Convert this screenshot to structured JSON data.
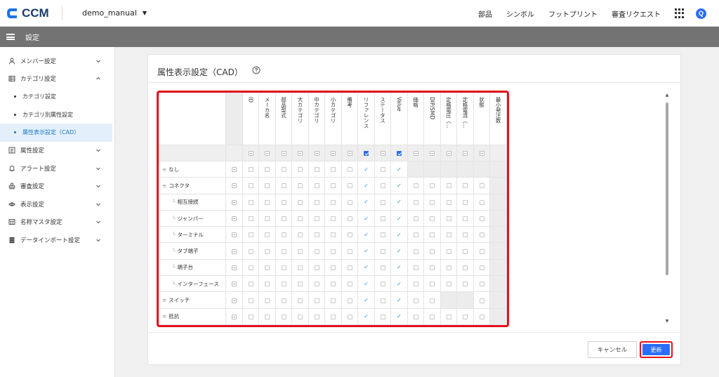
{
  "app": {
    "name": "CCM",
    "project": "demo_manual",
    "accent": "#2a6ef5",
    "highlight": "#e6101c"
  },
  "topnav": [
    {
      "label": "部品"
    },
    {
      "label": "シンボル"
    },
    {
      "label": "フットプリント"
    },
    {
      "label": "審査リクエスト"
    }
  ],
  "user_initial": "Q",
  "subbar": {
    "title": "設定"
  },
  "sidebar": {
    "items": [
      {
        "label": "メンバー設定",
        "icon": "person-icon",
        "chevron": "down"
      },
      {
        "label": "カテゴリ設定",
        "icon": "grid-icon",
        "chevron": "up"
      },
      {
        "label": "属性設定",
        "icon": "list-icon",
        "chevron": "down"
      },
      {
        "label": "アラート設定",
        "icon": "bell-icon",
        "chevron": "down"
      },
      {
        "label": "審査設定",
        "icon": "stamp-icon",
        "chevron": "down"
      },
      {
        "label": "表示設定",
        "icon": "eye-icon",
        "chevron": "down"
      },
      {
        "label": "名称マスタ設定",
        "icon": "table-icon",
        "chevron": "down"
      },
      {
        "label": "データインポート設定",
        "icon": "database-icon",
        "chevron": "down"
      }
    ],
    "subitems": [
      {
        "label": "カテゴリ設定"
      },
      {
        "label": "カテゴリ別属性設定"
      },
      {
        "label": "属性表示設定（CAD）",
        "active": true
      }
    ]
  },
  "page": {
    "title": "属性表示設定（CAD）"
  },
  "table": {
    "columns": [
      "ID",
      "メーカ名",
      "部品型式",
      "大カテゴリ",
      "中カテゴリ",
      "小カテゴリ",
      "備考",
      "リファレンス",
      "ステータス",
      "Value",
      "価格",
      "DIP/SMD",
      "定格電圧（…",
      "定格電流（…",
      "状態",
      "最小発注数"
    ],
    "header_checked": [
      false,
      false,
      false,
      false,
      false,
      false,
      false,
      true,
      false,
      true,
      false,
      false,
      false,
      false,
      false
    ],
    "rows": [
      {
        "label": "なし",
        "level": 0,
        "cells": [
          "o",
          "o",
          "o",
          "o",
          "o",
          "o",
          "o",
          "t",
          "o",
          "t",
          "g",
          "g",
          "g",
          "g",
          "g"
        ]
      },
      {
        "label": "コネクタ",
        "level": 0,
        "cells": [
          "o",
          "o",
          "o",
          "o",
          "o",
          "o",
          "o",
          "t",
          "o",
          "t",
          "o",
          "o",
          "o",
          "o",
          "o"
        ]
      },
      {
        "label": "相互接続",
        "level": 1,
        "cells": [
          "o",
          "o",
          "o",
          "o",
          "o",
          "o",
          "o",
          "t",
          "o",
          "t",
          "o",
          "o",
          "o",
          "o",
          "o"
        ]
      },
      {
        "label": "ジャンパー",
        "level": 1,
        "cells": [
          "o",
          "o",
          "o",
          "o",
          "o",
          "o",
          "o",
          "t",
          "o",
          "t",
          "o",
          "o",
          "o",
          "o",
          "o"
        ]
      },
      {
        "label": "ターミナル",
        "level": 1,
        "cells": [
          "o",
          "o",
          "o",
          "o",
          "o",
          "o",
          "o",
          "t",
          "o",
          "t",
          "o",
          "o",
          "o",
          "o",
          "o"
        ]
      },
      {
        "label": "タブ端子",
        "level": 1,
        "cells": [
          "o",
          "o",
          "o",
          "o",
          "o",
          "o",
          "o",
          "t",
          "o",
          "t",
          "o",
          "o",
          "o",
          "o",
          "o"
        ]
      },
      {
        "label": "端子台",
        "level": 1,
        "cells": [
          "o",
          "o",
          "o",
          "o",
          "o",
          "o",
          "o",
          "t",
          "o",
          "t",
          "o",
          "o",
          "o",
          "o",
          "o"
        ]
      },
      {
        "label": "インターフェース",
        "level": 1,
        "cells": [
          "o",
          "o",
          "o",
          "o",
          "o",
          "o",
          "o",
          "t",
          "o",
          "t",
          "o",
          "o",
          "o",
          "o",
          "o"
        ]
      },
      {
        "label": "スイッチ",
        "level": 0,
        "cells": [
          "o",
          "o",
          "o",
          "o",
          "o",
          "o",
          "o",
          "t",
          "o",
          "t",
          "o",
          "o",
          "g",
          "g",
          "o"
        ]
      },
      {
        "label": "抵抗",
        "level": 0,
        "cells": [
          "o",
          "o",
          "o",
          "o",
          "o",
          "o",
          "o",
          "t",
          "o",
          "t",
          "o",
          "o",
          "o",
          "o",
          "o"
        ]
      }
    ]
  },
  "buttons": {
    "cancel": "キャンセル",
    "update": "更新"
  }
}
